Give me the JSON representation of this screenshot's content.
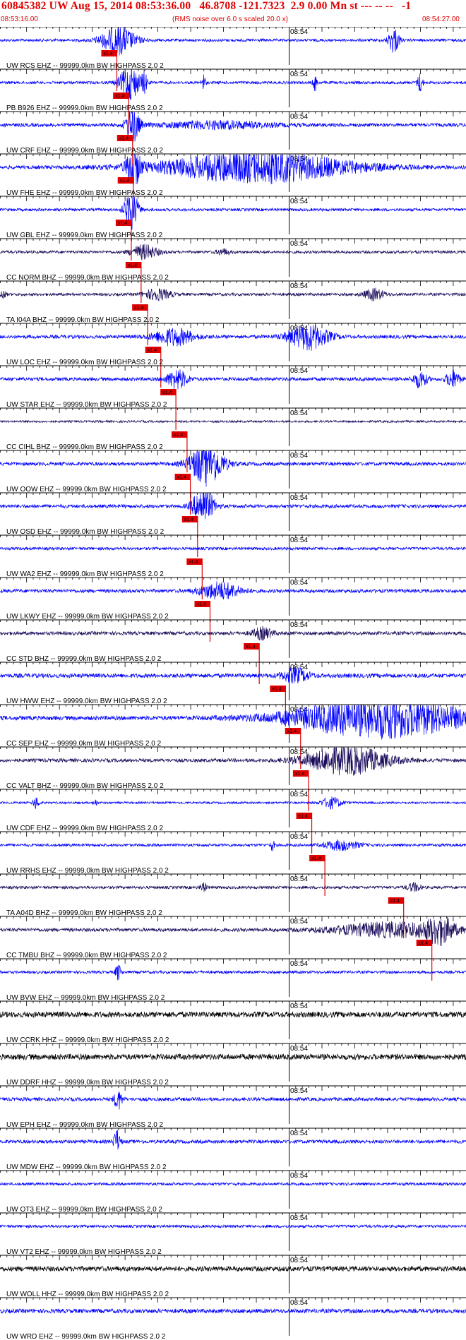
{
  "header": {
    "title": "60845382 UW Aug 15, 2014 08:53:36.00   46.8708 -121.7323  2.9 0.00 Mn st --- -- --   -1",
    "start_time": "08:53:16.00",
    "note": "(RMS noise over 6.0 s scaled 20.0 x)",
    "end_time": "08:54:27.00"
  },
  "chart_data": {
    "type": "seismogram",
    "time_start": "08:53:16.00",
    "time_end": "08:54:27.00",
    "minute_label": "08:54",
    "minute_offset_s": 44,
    "pick_label": "x1.4",
    "colors": {
      "blue": "#0000ff",
      "navy": "#1a0a5a",
      "black": "#000000",
      "pick": "#e00000"
    },
    "traces": [
      {
        "label": "UW RCS EHZ -- 99999.0km BW  HIGHPASS  2.0  2",
        "pick_s": 17.8,
        "color": "blue",
        "noise": 2,
        "bursts": [
          [
            18.0,
            2.5,
            20
          ],
          [
            60.0,
            0.8,
            18
          ]
        ]
      },
      {
        "label": "PB B926 EHZ -- 99999.0km BW  HIGHPASS  2.0  2",
        "pick_s": 19.6,
        "color": "blue",
        "noise": 2,
        "bursts": [
          [
            19.8,
            1.5,
            24
          ],
          [
            22.0,
            0.4,
            14
          ],
          [
            31.0,
            0.3,
            12
          ],
          [
            48.0,
            0.3,
            12
          ],
          [
            64.0,
            0.4,
            14
          ]
        ]
      },
      {
        "label": "UW CRF EHZ -- 99999.0km BW  HIGHPASS  2.0  2",
        "pick_s": 20.2,
        "color": "blue",
        "noise": 2.5,
        "bursts": [
          [
            20.2,
            1.0,
            26
          ],
          [
            33.0,
            8.0,
            5
          ]
        ]
      },
      {
        "label": "UW FHE EHZ -- 99999.0km BW  HIGHPASS  2.0  2",
        "pick_s": 20.3,
        "color": "blue",
        "noise": 2.5,
        "bursts": [
          [
            20.3,
            1.0,
            28
          ],
          [
            39.0,
            14.0,
            22
          ]
        ]
      },
      {
        "label": "UW GBL EHZ -- 99999.0km BW  HIGHPASS  2.0  2",
        "pick_s": 20.0,
        "color": "blue",
        "noise": 2,
        "bursts": [
          [
            20.0,
            1.0,
            30
          ]
        ]
      },
      {
        "label": "CC NORM BHZ -- 99999.0km BW  HIGHPASS  2.0  2",
        "pick_s": 21.5,
        "color": "navy",
        "noise": 2,
        "bursts": [
          [
            22.0,
            2.0,
            10
          ],
          [
            34.0,
            1.0,
            4
          ]
        ]
      },
      {
        "label": "TA I04A BHZ -- 99999.0km BW  HIGHPASS  2.0  2",
        "pick_s": 22.5,
        "color": "navy",
        "noise": 2,
        "bursts": [
          [
            24.0,
            2.0,
            8
          ],
          [
            57.0,
            1.5,
            8
          ],
          [
            0.5,
            0.4,
            6
          ]
        ]
      },
      {
        "label": "UW LOC EHZ -- 99999.0km BW  HIGHPASS  2.0  2",
        "pick_s": 24.5,
        "color": "blue",
        "noise": 2.5,
        "bursts": [
          [
            26.5,
            3.0,
            12
          ],
          [
            47.0,
            3.0,
            18
          ]
        ]
      },
      {
        "label": "UW STAR EHZ -- 99999.0km BW  HIGHPASS  2.0  2",
        "pick_s": 26.8,
        "color": "blue",
        "noise": 2.5,
        "bursts": [
          [
            27.0,
            1.5,
            14
          ],
          [
            64.0,
            1.0,
            12
          ],
          [
            69.0,
            1.0,
            12
          ]
        ]
      },
      {
        "label": "CC CIHL BHZ -- 99999.0km BW  HIGHPASS  2.0  2",
        "pick_s": 28.5,
        "color": "navy",
        "noise": 1.5,
        "bursts": []
      },
      {
        "label": "UW OOW EHZ -- 99999.0km BW  HIGHPASS  2.0  2",
        "pick_s": 29.0,
        "color": "blue",
        "noise": 2.5,
        "bursts": [
          [
            31.5,
            2.5,
            30
          ]
        ]
      },
      {
        "label": "UW OSD EHZ -- 99999.0km BW  HIGHPASS  2.0  2",
        "pick_s": 30.1,
        "color": "blue",
        "noise": 2.5,
        "bursts": [
          [
            31.0,
            1.5,
            28
          ]
        ]
      },
      {
        "label": "UW WA2 EHZ -- 99999.0km BW  HIGHPASS  2.0  2",
        "pick_s": 30.8,
        "color": "blue",
        "noise": 2.0,
        "bursts": []
      },
      {
        "label": "UW LKWY EHZ -- 99999.0km BW  HIGHPASS  2.0  2",
        "pick_s": 32.0,
        "color": "blue",
        "noise": 2.5,
        "bursts": [
          [
            33.5,
            3.0,
            12
          ]
        ]
      },
      {
        "label": "CC STD BHZ -- 99999.0km BW  HIGHPASS  2.0  2",
        "pick_s": 39.5,
        "color": "navy",
        "noise": 2.5,
        "bursts": [
          [
            40.0,
            1.5,
            8
          ]
        ]
      },
      {
        "label": "UW HWW EHZ -- 99999.0km BW  HIGHPASS  2.0  2",
        "pick_s": 43.5,
        "color": "blue",
        "noise": 3,
        "bursts": [
          [
            45.0,
            2.0,
            10
          ]
        ]
      },
      {
        "label": "CC SEP EHZ -- 99999.0km BW  HIGHPASS  2.0  2",
        "pick_s": 45.8,
        "color": "blue",
        "noise": 3,
        "bursts": [
          [
            58.0,
            13.0,
            28
          ]
        ]
      },
      {
        "label": "CC VALT BHZ -- 99999.0km BW  HIGHPASS  2.0  2",
        "pick_s": 47.0,
        "color": "navy",
        "noise": 2.5,
        "bursts": [
          [
            53.0,
            6.0,
            20
          ]
        ]
      },
      {
        "label": "UW CDF EHZ -- 99999.0km BW  HIGHPASS  2.0  2",
        "pick_s": 47.5,
        "color": "blue",
        "noise": 1.5,
        "bursts": [
          [
            5.5,
            0.5,
            8
          ],
          [
            14.5,
            0.3,
            5
          ],
          [
            50.5,
            1.5,
            8
          ]
        ]
      },
      {
        "label": "UW RRHS EHZ -- 99999.0km BW  HIGHPASS  2.0  2",
        "pick_s": 49.5,
        "color": "blue",
        "noise": 2,
        "bursts": [
          [
            52.0,
            2.5,
            7
          ],
          [
            41.5,
            0.3,
            8
          ]
        ]
      },
      {
        "label": "TA A04D BHZ -- 99999.0km BW  HIGHPASS  2.0  2",
        "pick_s": 61.5,
        "color": "navy",
        "noise": 2,
        "bursts": [
          [
            31.0,
            0.5,
            6
          ],
          [
            63.0,
            1.0,
            6
          ]
        ]
      },
      {
        "label": "CC TMBU BHZ -- 99999.0km BW  HIGHPASS  2.0  2",
        "pick_s": 65.8,
        "color": "navy",
        "noise": 2.5,
        "bursts": [
          [
            60.0,
            9.0,
            10
          ],
          [
            67.0,
            2.0,
            16
          ]
        ]
      },
      {
        "label": "UW BVW EHZ -- 99999.0km BW  HIGHPASS  2.0  2",
        "pick_s": null,
        "color": "blue",
        "noise": 2,
        "bursts": [
          [
            18.0,
            0.4,
            12
          ]
        ]
      },
      {
        "label": "UW CCRK HHZ -- 99999.0km BW  HIGHPASS  2.0  2",
        "pick_s": null,
        "color": "black",
        "noise": 4,
        "bursts": []
      },
      {
        "label": "UW DDRF HHZ -- 99999.0km BW  HIGHPASS  2.0  2",
        "pick_s": null,
        "color": "black",
        "noise": 4,
        "bursts": []
      },
      {
        "label": "UW EPH EHZ -- 99999.0km BW  HIGHPASS  2.0  2",
        "pick_s": null,
        "color": "blue",
        "noise": 2.5,
        "bursts": [
          [
            18.0,
            0.6,
            14
          ]
        ]
      },
      {
        "label": "UW MDW EHZ -- 99999.0km BW  HIGHPASS  2.0  2",
        "pick_s": null,
        "color": "blue",
        "noise": 2.5,
        "bursts": [
          [
            17.8,
            0.5,
            16
          ]
        ]
      },
      {
        "label": "UW OT3 EHZ -- 99999.0km BW  HIGHPASS  2.0  2",
        "pick_s": null,
        "color": "blue",
        "noise": 2,
        "bursts": []
      },
      {
        "label": "UW VT2 EHZ -- 99999.0km BW  HIGHPASS  2.0  2",
        "pick_s": null,
        "color": "blue",
        "noise": 2,
        "bursts": []
      },
      {
        "label": "UW WOLL HHZ -- 99999.0km BW  HIGHPASS  2.0  2",
        "pick_s": null,
        "color": "black",
        "noise": 3.5,
        "bursts": []
      },
      {
        "label": "UW WRD EHZ -- 99999.0km BW  HIGHPASS  2.0  2",
        "pick_s": null,
        "color": "blue",
        "noise": 3,
        "bursts": []
      }
    ]
  }
}
